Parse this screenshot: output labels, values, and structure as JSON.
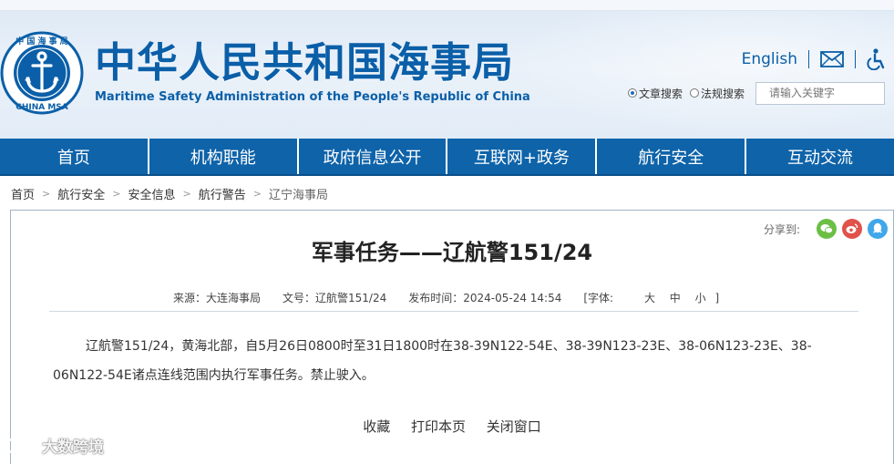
{
  "header": {
    "title_cn": "中华人民共和国海事局",
    "title_en": "Maritime Safety Administration of the People's Republic of China",
    "logo_ring_top": "中 国 海 事 局",
    "logo_ring_bottom": "CHINA MSA",
    "english_link": "English",
    "search_options": [
      "文章搜索",
      "法规搜索"
    ],
    "search_selected": "文章搜索",
    "search_placeholder": "请输入关键字"
  },
  "nav": [
    "首页",
    "机构职能",
    "政府信息公开",
    "互联网+政务",
    "航行安全",
    "互动交流"
  ],
  "breadcrumb": [
    "首页",
    "航行安全",
    "安全信息",
    "航行警告",
    "辽宁海事局"
  ],
  "article": {
    "share_label": "分享到:",
    "title": "军事任务——辽航警151/24",
    "source": "来源：大连海事局",
    "doc_no": "文号：辽航警151/24",
    "publish_time": "发布时间：2024-05-24 14:54",
    "font_label": "[字体:",
    "font_sizes": [
      "大",
      "中",
      "小"
    ],
    "font_close": "]",
    "body": "辽航警151/24，黄海北部，自5月26日0800时至31日1800时在38-39N122-54E、38-39N123-23E、38-06N123-23E、38-06N122-54E诸点连线范围内执行军事任务。禁止驶入。",
    "actions": [
      "收藏",
      "打印本页",
      "关闭窗口"
    ]
  },
  "watermark": "大数跨境",
  "colors": {
    "brand_blue": "#0e63a9",
    "title_blue": "#0b5fa8",
    "wechat": "#6bbf45",
    "weibo": "#e0524a",
    "qq": "#3fa7ea"
  }
}
